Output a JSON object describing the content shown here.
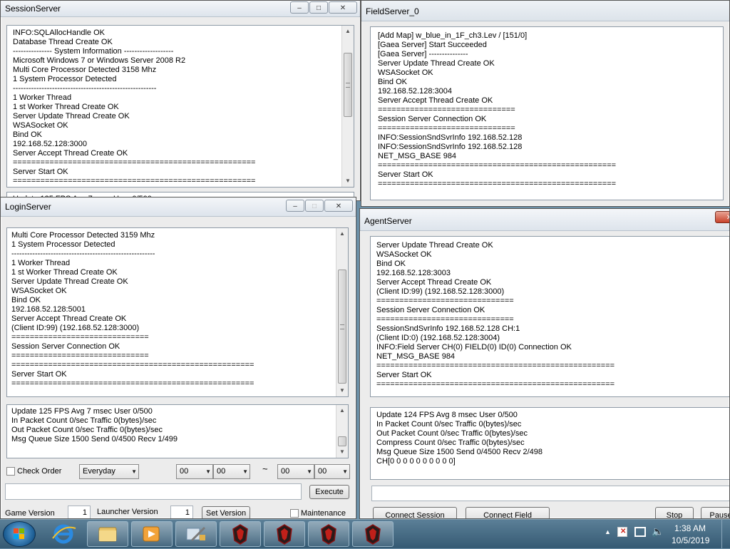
{
  "session_server": {
    "title": "SessionServer",
    "log": [
      "INFO:SQLAllocHandle OK",
      "Database Thread Create OK",
      "--------------- System Information -------------------",
      "Microsoft Windows 7 or Windows Server 2008 R2",
      "Multi Core Processor Detected 3158 Mhz",
      "1 System Processor Detected",
      "-------------------------------------------------------",
      "1 Worker Thread",
      "1 st Worker Thread Create OK",
      "Server Update Thread Create OK",
      "WSASocket OK",
      "Bind OK",
      "192.168.52.128:3000",
      "Server Accept Thread Create OK",
      "=====================================================",
      "Server Start OK",
      "====================================================="
    ],
    "status_partial": "Update 125 FPS Avg 7msec User 0/500"
  },
  "field_server": {
    "title": "FieldServer_0",
    "log": [
      "[Add Map] w_blue_in_1F_ch3.Lev  / [151/0]",
      "[Gaea Server] Start Succeeded",
      "[Gaea Server] ---------------",
      "Server Update Thread Create OK",
      "WSASocket OK",
      "Bind OK",
      "192.168.52.128:3004",
      "Server Accept Thread Create OK",
      "==============================",
      "Session Server Connection OK",
      "==============================",
      "INFO:SessionSndSvrInfo 192.168.52.128",
      "INFO:SessionSndSvrInfo 192.168.52.128",
      "NET_MSG_BASE 984",
      "====================================================",
      "Server Start OK",
      "===================================================="
    ]
  },
  "login_server": {
    "title": "LoginServer",
    "log": [
      "Multi Core Processor Detected 3159 Mhz",
      "1 System Processor Detected",
      "-------------------------------------------------------",
      "1 Worker Thread",
      "1 st Worker Thread Create OK",
      "Server Update Thread Create OK",
      "WSASocket OK",
      "Bind OK",
      "192.168.52.128:5001",
      "Server Accept Thread Create OK",
      "(Client ID:99) (192.168.52.128:3000)",
      "==============================",
      "Session Server Connection OK",
      "==============================",
      "=====================================================",
      "Server Start OK",
      "====================================================="
    ],
    "status": [
      "Update 125 FPS Avg 7 msec User 0/500",
      "In Packet Count 0/sec Traffic 0(bytes)/sec",
      "Out Packet Count 0/sec Traffic 0(bytes)/sec",
      "Msg Queue Size 1500 Send 0/4500 Recv 1/499"
    ],
    "check_order_label": "Check Order",
    "schedule_value": "Everyday",
    "hour_from": "00",
    "minute_from": "00",
    "tilde": "~",
    "hour_to": "00",
    "minute_to": "00",
    "execute_label": "Execute",
    "game_version_label": "Game Version",
    "game_version_value": "1",
    "launcher_version_label": "Launcher Version",
    "launcher_version_value": "1",
    "set_version_label": "Set Version",
    "maintenance_label": "Maintenance"
  },
  "agent_server": {
    "title": "AgentServer",
    "log": [
      "Server Update Thread Create OK",
      "WSASocket OK",
      "Bind OK",
      "192.168.52.128:3003",
      "Server Accept Thread Create OK",
      "(Client ID:99) (192.168.52.128:3000)",
      "==============================",
      "Session Server Connection OK",
      "==============================",
      "SessionSndSvrInfo 192.168.52.128 CH:1",
      "(Client ID:0) (192.168.52.128:3004)",
      "INFO:Field Server CH(0) FIELD(0) ID(0) Connection OK",
      "NET_MSG_BASE 984",
      "====================================================",
      "Server Start OK",
      "===================================================="
    ],
    "status": [
      "Update 124 FPS Avg 8 msec User 0/500",
      "In Packet Count 0/sec Traffic 0(bytes)/sec",
      "Out Packet Count 0/sec Traffic 0(bytes)/sec",
      "Compress Count 0/sec Traffic 0(bytes)/sec",
      "Msg Queue Size 1500 Send 0/4500 Recv 2/498",
      "CH[0 0 0 0 0 0 0 0 0 0]"
    ],
    "connect_session_label": "Connect Session",
    "connect_field_label": "Connect Field",
    "stop_label": "Stop",
    "pause_label": "Pause"
  },
  "taskbar": {
    "time": "1:38 AM",
    "date": "10/5/2019",
    "items": [
      "explorer-icon",
      "media-player-icon",
      "tools-icon",
      "game-server-icon",
      "game-server-icon",
      "game-server-icon",
      "game-server-icon"
    ]
  },
  "colors": {
    "desktop": "#6b8fa6",
    "taskbar": "#3f6781",
    "window_bg": "#ececec",
    "close_red": "#c8432c"
  }
}
